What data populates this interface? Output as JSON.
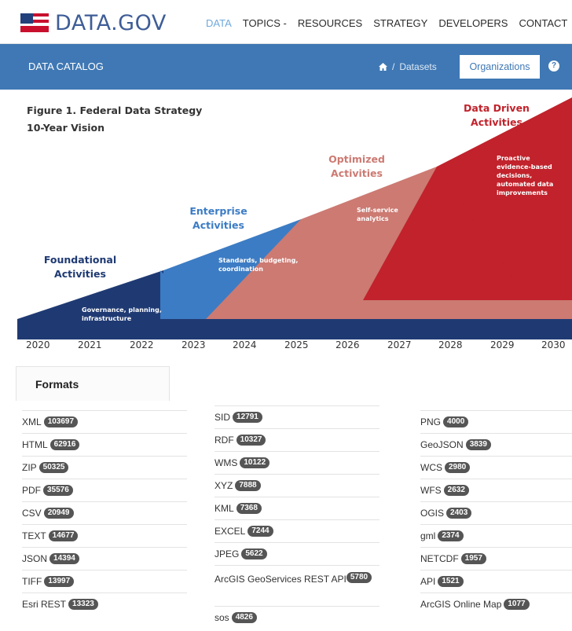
{
  "site": {
    "logo": "DATA.GOV"
  },
  "nav": {
    "items": [
      {
        "label": "DATA",
        "active": true
      },
      {
        "label": "TOPICS -"
      },
      {
        "label": "RESOURCES"
      },
      {
        "label": "STRATEGY"
      },
      {
        "label": "DEVELOPERS"
      },
      {
        "label": "CONTACT"
      }
    ]
  },
  "catalog": {
    "title": "DATA CATALOG",
    "separator": "/",
    "crumb": "Datasets",
    "active": "Organizations",
    "help": "?"
  },
  "figure": {
    "title_line1": "Figure 1. Federal Data Strategy",
    "title_line2": "10-Year Vision",
    "phases": [
      {
        "line1": "Foundational",
        "line2": "Activities",
        "desc1": "Governance, planning,",
        "desc2": "infrastructure",
        "color": "#1f3a73",
        "label_color": "#1f3a73"
      },
      {
        "line1": "Enterprise",
        "line2": "Activities",
        "desc1": "Standards, budgeting,",
        "desc2": "coordination",
        "color": "#3c7cc4",
        "label_color": "#3c7cc4"
      },
      {
        "line1": "Optimized",
        "line2": "Activities",
        "desc1": "Self-service",
        "desc2": "analytics",
        "color": "#cc7a72",
        "label_color": "#cc7a72"
      },
      {
        "line1": "Data Driven",
        "line2": "Activities",
        "desc1": "Proactive",
        "desc2": "evidence-based",
        "desc3": "decisions,",
        "desc4": "automated data",
        "desc5": "improvements",
        "color": "#c1222b",
        "label_color": "#c1222b"
      }
    ],
    "years": [
      "2020",
      "2021",
      "2022",
      "2023",
      "2024",
      "2025",
      "2026",
      "2027",
      "2028",
      "2029",
      "2030"
    ]
  },
  "formats": {
    "title": "Formats",
    "col1": [
      {
        "name": "XML",
        "count": "103697"
      },
      {
        "name": "HTML",
        "count": "62916"
      },
      {
        "name": "ZIP",
        "count": "50325"
      },
      {
        "name": "PDF",
        "count": "35576"
      },
      {
        "name": "CSV",
        "count": "20949"
      },
      {
        "name": "TEXT",
        "count": "14677"
      },
      {
        "name": "JSON",
        "count": "14394"
      },
      {
        "name": "TIFF",
        "count": "13997"
      },
      {
        "name": "Esri REST",
        "count": "13323"
      }
    ],
    "col2": [
      {
        "name": "SID",
        "count": "12791"
      },
      {
        "name": "RDF",
        "count": "10327"
      },
      {
        "name": "WMS",
        "count": "10122"
      },
      {
        "name": "XYZ",
        "count": "7888"
      },
      {
        "name": "KML",
        "count": "7368"
      },
      {
        "name": "EXCEL",
        "count": "7244"
      },
      {
        "name": "JPEG",
        "count": "5622"
      },
      {
        "name": "ArcGIS GeoServices REST API",
        "count": "5780"
      },
      {
        "name": "sos",
        "count": "4826"
      }
    ],
    "col3": [
      {
        "name": "PNG",
        "count": "4000"
      },
      {
        "name": "GeoJSON",
        "count": "3839"
      },
      {
        "name": "WCS",
        "count": "2980"
      },
      {
        "name": "WFS",
        "count": "2632"
      },
      {
        "name": "OGIS",
        "count": "2403"
      },
      {
        "name": "gml",
        "count": "2374"
      },
      {
        "name": "NETCDF",
        "count": "1957"
      },
      {
        "name": "API",
        "count": "1521"
      },
      {
        "name": "ArcGIS Online Map",
        "count": "1077"
      }
    ]
  }
}
